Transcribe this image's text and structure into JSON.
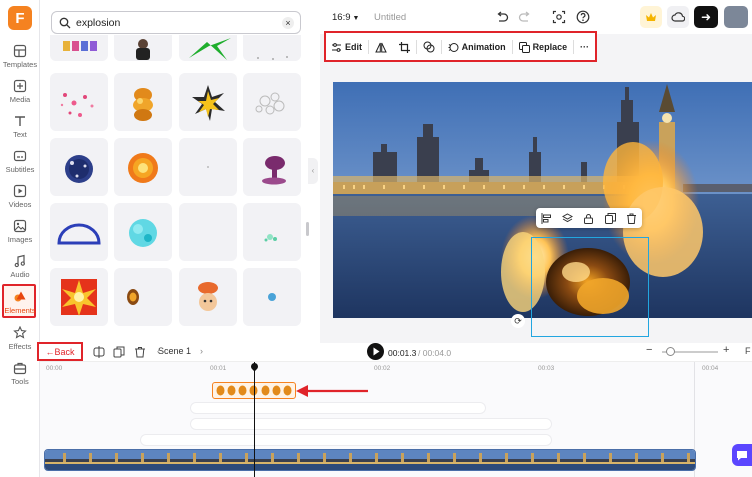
{
  "app": {
    "logo_letter": "F"
  },
  "rail": {
    "items": [
      {
        "label": "Templates",
        "icon": "templates-icon"
      },
      {
        "label": "Media",
        "icon": "media-icon"
      },
      {
        "label": "Text",
        "icon": "text-icon"
      },
      {
        "label": "Subtitles",
        "icon": "subtitles-icon"
      },
      {
        "label": "Videos",
        "icon": "videos-icon"
      },
      {
        "label": "Images",
        "icon": "images-icon"
      },
      {
        "label": "Audio",
        "icon": "audio-icon"
      },
      {
        "label": "Elements",
        "icon": "elements-icon",
        "active": true
      },
      {
        "label": "Effects",
        "icon": "effects-icon"
      },
      {
        "label": "Tools",
        "icon": "tools-icon"
      }
    ]
  },
  "search": {
    "value": "explosion",
    "clear_glyph": "×"
  },
  "topbar": {
    "ratio": "16:9",
    "title": "Untitled"
  },
  "toolbar": {
    "edit": "Edit",
    "animation": "Animation",
    "replace": "Replace",
    "more": "···"
  },
  "controls": {
    "back": "←Back",
    "scene": "Scene 1",
    "time_current": "00:01.3",
    "time_total": "/ 00:04.0",
    "zoom_minus": "−",
    "zoom_plus": "+",
    "fit": "F",
    "zoom_level": 0.15
  },
  "timeline": {
    "ticks": [
      "00:00",
      "00:01",
      "00:02",
      "00:03",
      "00:04"
    ]
  },
  "colors": {
    "accent": "#f58220",
    "highlight": "#e0242a",
    "selection": "#22a6e0"
  }
}
